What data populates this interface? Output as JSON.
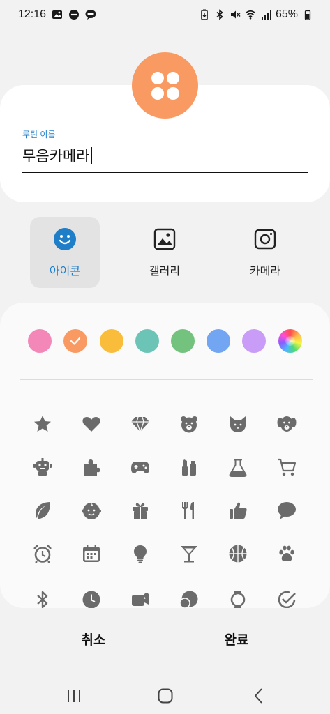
{
  "status_bar": {
    "time": "12:16",
    "battery": "65%",
    "left_icons": [
      "gallery-notification-icon",
      "messenger-icon",
      "talk-icon"
    ],
    "right_icons": [
      "battery-saver-icon",
      "bluetooth-icon",
      "mute-icon",
      "wifi-icon",
      "signal-icon",
      "battery-icon"
    ]
  },
  "routine": {
    "icon": "four-dots-icon",
    "icon_color": "#fa9a63",
    "name_label": "루틴 이름",
    "name_value": "무음카메라"
  },
  "source_tabs": [
    {
      "label": "아이콘",
      "icon": "smiley-icon",
      "active": true
    },
    {
      "label": "갤러리",
      "icon": "gallery-icon",
      "active": false
    },
    {
      "label": "카메라",
      "icon": "camera-icon",
      "active": false
    }
  ],
  "colors": [
    {
      "name": "pink",
      "hex": "#f287b8",
      "selected": false
    },
    {
      "name": "orange",
      "hex": "#fa9a63",
      "selected": true
    },
    {
      "name": "yellow",
      "hex": "#f9bd3b",
      "selected": false
    },
    {
      "name": "teal",
      "hex": "#6cc4b6",
      "selected": false
    },
    {
      "name": "green",
      "hex": "#73c27e",
      "selected": false
    },
    {
      "name": "blue",
      "hex": "#72a6f2",
      "selected": false
    },
    {
      "name": "purple",
      "hex": "#c89cf7",
      "selected": false
    },
    {
      "name": "rainbow",
      "hex": "gradient",
      "selected": false
    }
  ],
  "icons": [
    [
      "star-icon",
      "heart-icon",
      "diamond-icon",
      "bear-icon",
      "cat-icon",
      "dog-icon"
    ],
    [
      "robot-icon",
      "puzzle-icon",
      "gamepad-icon",
      "lipstick-icon",
      "flask-icon",
      "cart-icon"
    ],
    [
      "leaf-icon",
      "baby-icon",
      "gift-icon",
      "cutlery-icon",
      "thumbs-up-icon",
      "chat-icon"
    ],
    [
      "alarm-icon",
      "calendar-icon",
      "bulb-icon",
      "cocktail-icon",
      "basketball-icon",
      "paw-icon"
    ],
    [
      "bluetooth-icon",
      "clock-icon",
      "video-icon",
      "moon-icon",
      "watch-icon",
      "check-circle-icon"
    ]
  ],
  "icon_color": "#6b6b6b",
  "accent": "#1e7ec8",
  "actions": {
    "cancel": "취소",
    "done": "완료"
  },
  "nav": [
    "recents-icon",
    "home-icon",
    "back-icon"
  ]
}
